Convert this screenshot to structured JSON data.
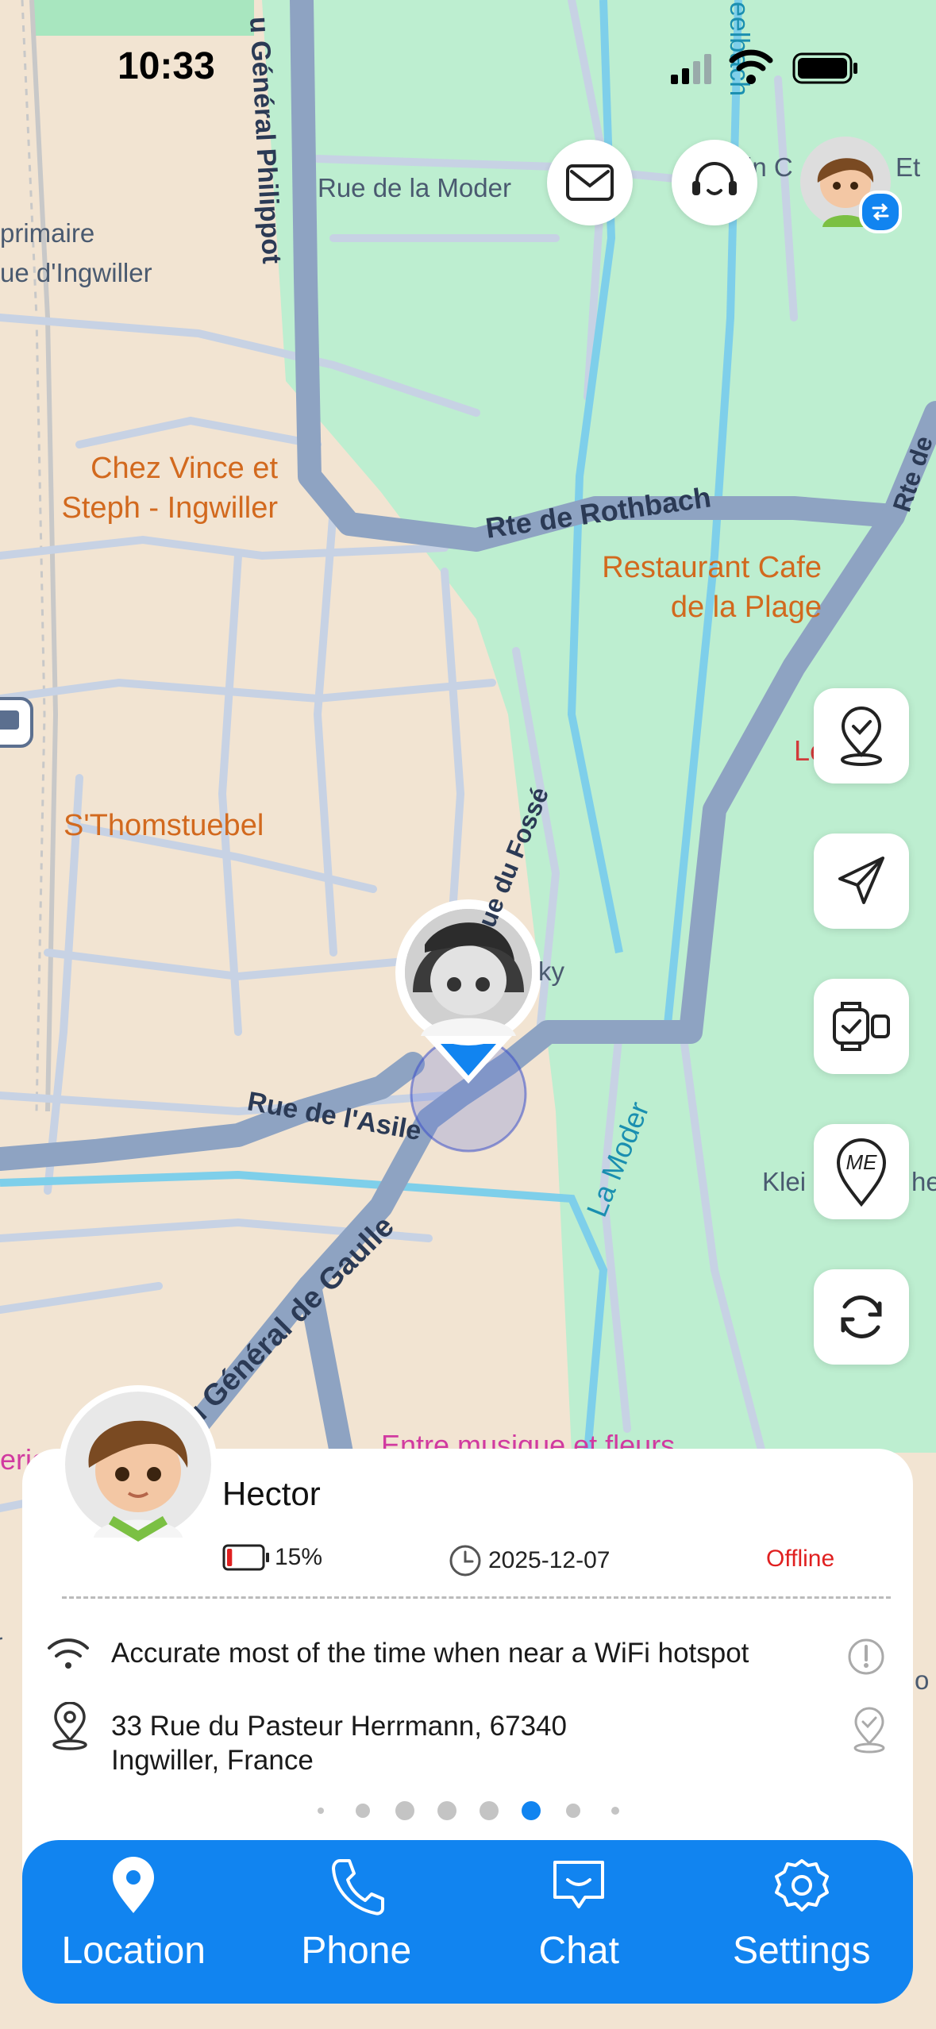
{
  "status_bar": {
    "time": "10:33"
  },
  "map": {
    "places": [
      {
        "id": "chez_vince",
        "text": "Chez Vince et\nSteph - Ingwiller"
      },
      {
        "id": "restaurant",
        "text": "Restaurant Cafe\nde la Plage"
      },
      {
        "id": "sthom",
        "text": "S'Thomstuebel"
      },
      {
        "id": "entre",
        "text": "Entre musique et fleurs"
      }
    ],
    "roads": {
      "gen_philippot": "u Général Philippot",
      "moder_rue": "Rue de la Moder",
      "rothbach": "Rte de Rothbach",
      "rte_d": "Rte de",
      "fosse": "ue du Fossé",
      "asile": "Rue de l'Asile",
      "gaulle": "u Général de Gaulle",
      "primaire": "primaire",
      "ingwiller": "ue d'Ingwiller",
      "ky": "ky",
      "klei": "Klei",
      "he": "he",
      "in_c": "in C",
      "et": "Et",
      "le": "Le",
      "eric": "eric",
      "te_de": "te de",
      "o": "o"
    },
    "rivers": {
      "la_moder": "La Moder",
      "seelbach": "eelbach"
    }
  },
  "device": {
    "name": "Hector",
    "battery": "15%",
    "battery_level": 0.15,
    "date": "2025-12-07",
    "status": "Offline",
    "accuracy_note": "Accurate most of the time when near a WiFi hotspot",
    "address_line1": "33 Rue du Pasteur Herrmann, 67340",
    "address_line2": "Ingwiller, France"
  },
  "side_buttons": {
    "geofence": "geofence-check-icon",
    "send": "paper-plane-icon",
    "watch": "watch-icon",
    "me": "ME",
    "refresh": "refresh-icon"
  },
  "pagination": {
    "count": 8,
    "active_index": 5
  },
  "tabs": [
    {
      "label": "Location",
      "icon": "location-pin-icon"
    },
    {
      "label": "Phone",
      "icon": "phone-icon"
    },
    {
      "label": "Chat",
      "icon": "chat-icon"
    },
    {
      "label": "Settings",
      "icon": "gear-icon"
    }
  ],
  "colors": {
    "accent": "#1184f0",
    "offline": "#e02020",
    "map_green": "#bdeed0",
    "map_beige": "#f2e4d2",
    "road": "#8ea3c2"
  }
}
